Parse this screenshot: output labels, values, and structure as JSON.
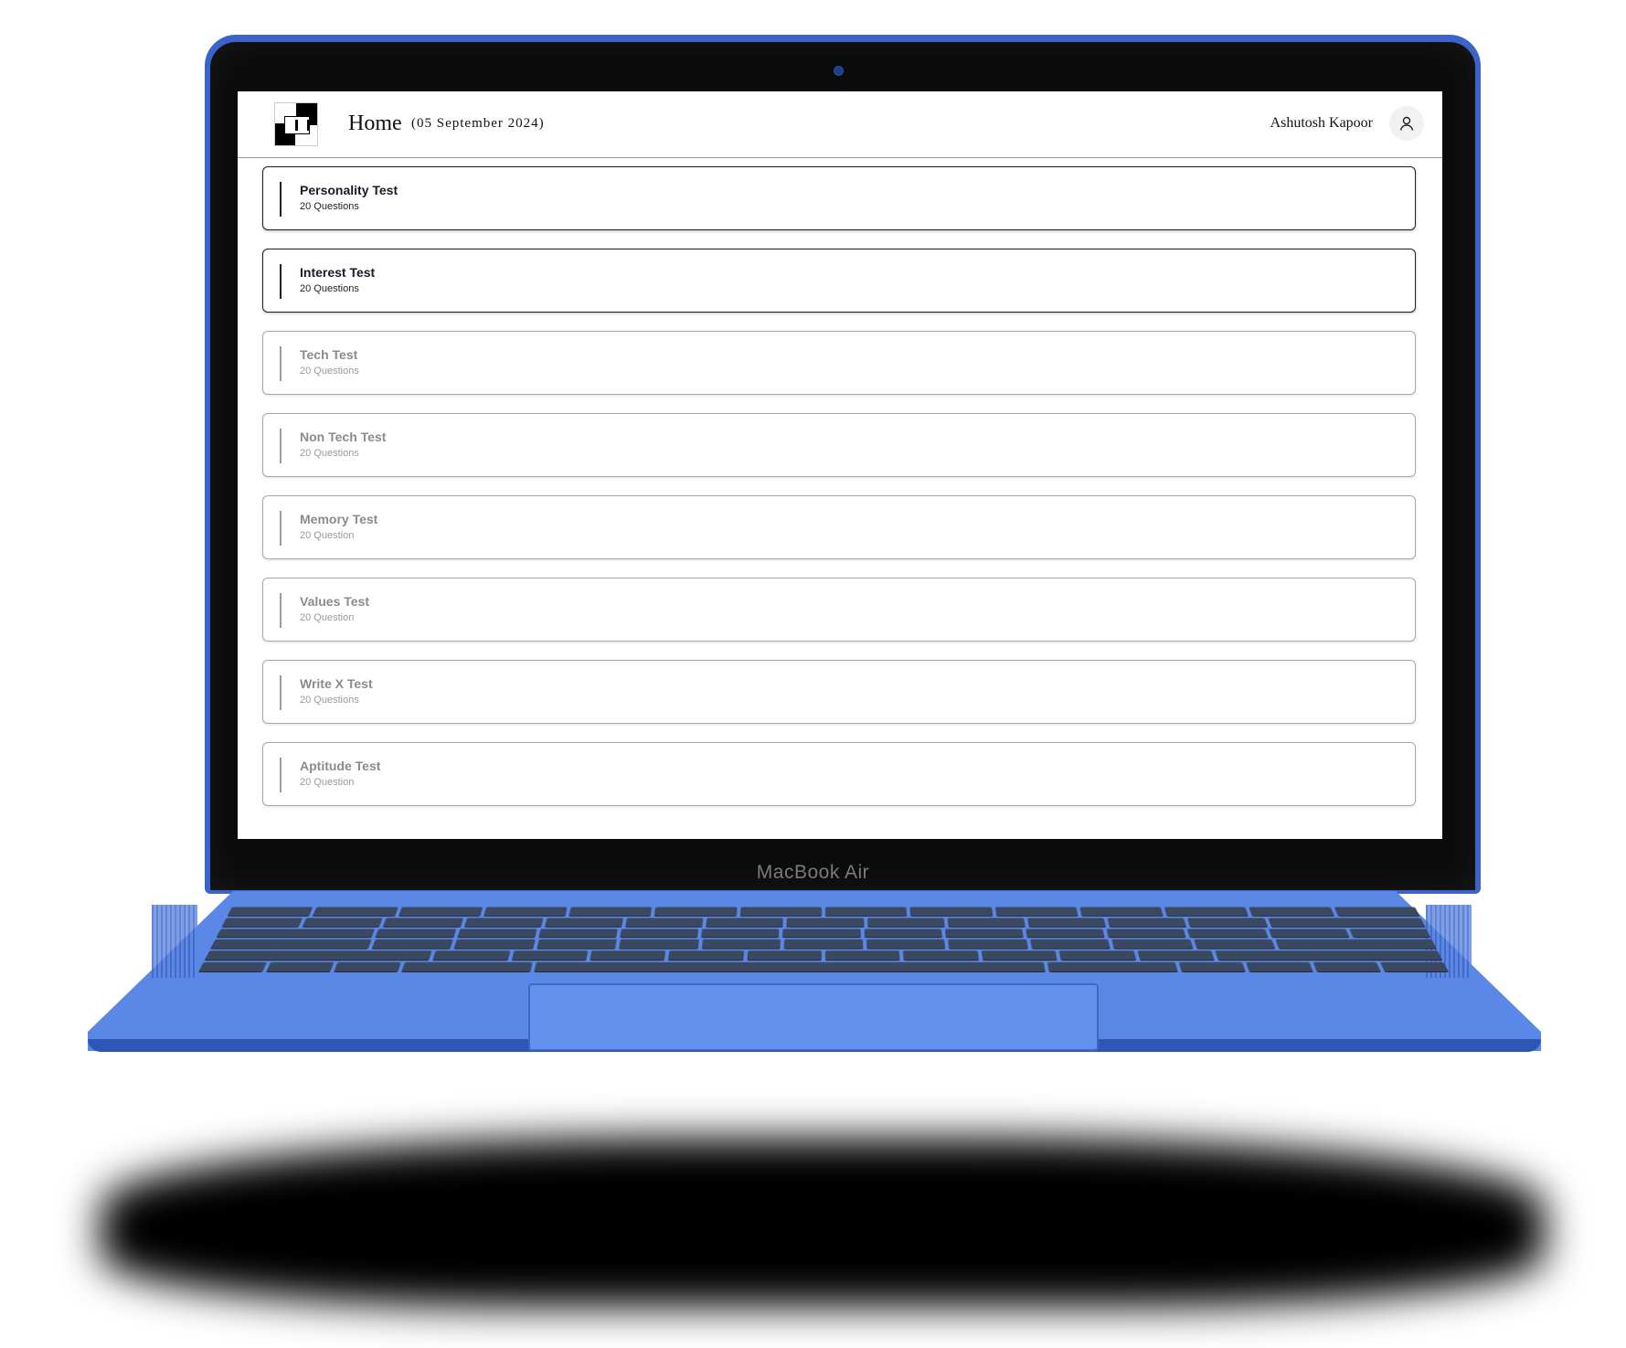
{
  "header": {
    "title": "Home",
    "date": "(05 September 2024)",
    "user_name": "Ashutosh Kapoor",
    "user_icon": "user-icon",
    "logo_icon": "brand-logo"
  },
  "tests": [
    {
      "name": "Personality Test",
      "count": "20 Questions",
      "state": "active"
    },
    {
      "name": "Interest Test",
      "count": "20 Questions",
      "state": "active"
    },
    {
      "name": "Tech Test",
      "count": "20 Questions",
      "state": "inactive"
    },
    {
      "name": "Non Tech Test",
      "count": "20 Questions",
      "state": "inactive"
    },
    {
      "name": "Memory Test",
      "count": "20 Question",
      "state": "inactive"
    },
    {
      "name": "Values Test",
      "count": "20 Question",
      "state": "inactive"
    },
    {
      "name": "Write X Test",
      "count": "20 Questions",
      "state": "inactive"
    },
    {
      "name": "Aptitude Test",
      "count": "20 Question",
      "state": "inactive"
    }
  ],
  "device": {
    "label": "MacBook Air",
    "body_color": "#3b63c9"
  }
}
